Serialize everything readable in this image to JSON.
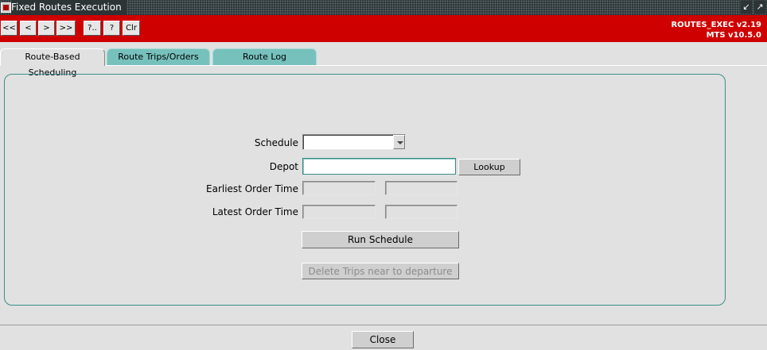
{
  "window": {
    "title": "Fixed Routes Execution",
    "app_icon": "oracle-forms-icon",
    "controls": [
      "minimize-icon",
      "maximize-icon"
    ]
  },
  "toolbar": {
    "buttons": {
      "first": "<<",
      "prev": "<",
      "next": ">",
      "last": ">>",
      "query": "?..",
      "help": "?",
      "clear": "Clr"
    },
    "form_name": "ROUTES_EXEC v2.19",
    "version": "MTS v10.5.0"
  },
  "tabs": [
    {
      "label": "Route-Based Scheduling",
      "active": true
    },
    {
      "label": "Route Trips/Orders",
      "active": false
    },
    {
      "label": "Route Log",
      "active": false
    }
  ],
  "form": {
    "schedule": {
      "label": "Schedule",
      "value": ""
    },
    "depot": {
      "label": "Depot",
      "value": "",
      "lookup_label": "Lookup"
    },
    "earliest_order_time": {
      "label": "Earliest Order Time",
      "value1": "",
      "value2": ""
    },
    "latest_order_time": {
      "label": "Latest Order Time",
      "value1": "",
      "value2": ""
    },
    "run_schedule_label": "Run Schedule",
    "delete_trips_label": "Delete Trips near to departure"
  },
  "footer": {
    "close_label": "Close"
  },
  "colors": {
    "toolbar_red": "#cf0000",
    "tab_teal": "#77c1bd",
    "panel_border": "#3c8f8a",
    "background": "#e1e1e1"
  }
}
